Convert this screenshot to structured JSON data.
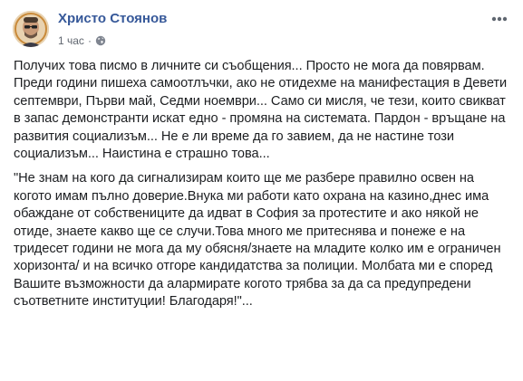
{
  "post": {
    "author": "Христо Стоянов",
    "time": "1 час",
    "separator": "·",
    "privacy_icon": "globe-icon",
    "menu_icon": "more-options-icon",
    "paragraphs": [
      "Получих това писмо в личните си съобщения... Просто не мога да повярвам. Преди години пишеха самоотлъчки, ако не отидехме на манифестация в Девети септември, Първи май, Седми ноември... Само си мисля, че тези, които свикват в запас демонстранти искат едно - промяна на системата. Пардон - връщане на развития социализъм... Не е ли време да го завием, да не настине този социализъм... Наистина е страшно това...",
      "\"Не знам на кого да сигнализирам които ще ме разбере правилно освен на когото имам пълно доверие.Внука ми работи като охрана на казино,днес има обаждане от собствениците да идват в София за протестите и ако някой не отиде, знаете какво ще се случи.Това много ме притеснява и понеже е на тридесет години не мога да му обясня/знаете на младите колко им е ограничен хоризонта/ и на всичко отгоре кандидатства за полиции. Молбата ми е според Вашите възможности да алармирате когото трябва за да са предупредени съответните институции! Благодаря!\"..."
    ]
  },
  "colors": {
    "author_link": "#365899",
    "meta_text": "#616770",
    "body_text": "#1c1e21",
    "background": "#ffffff"
  }
}
